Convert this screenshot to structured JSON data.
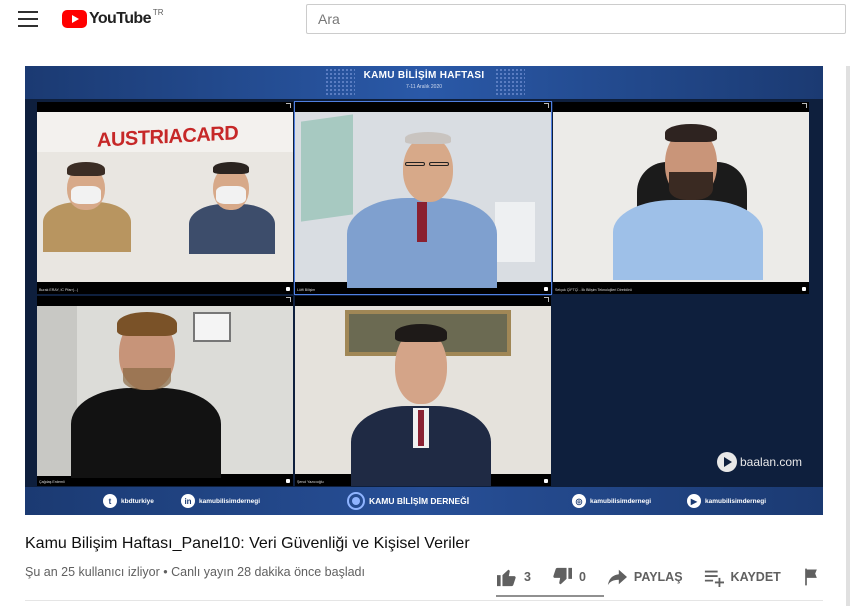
{
  "header": {
    "logo_text": "YouTube",
    "country_code": "TR",
    "search_placeholder": "Ara"
  },
  "video": {
    "banner_title": "KAMU BİLİŞİM HAFTASI",
    "banner_date": "7-11 Aralık 2020",
    "tiles": [
      {
        "name": "Burak ERAY, IC Pfarr(...)"
      },
      {
        "name": "Lütfi Bilişim"
      },
      {
        "name": "Selçuk ÇİFTÇİ - İlk Bilişim Teknolojileri Direktörü"
      },
      {
        "name": "Çağdaş Erdemli"
      },
      {
        "name": "Şenol Yazıcıoğlu"
      }
    ],
    "backdrop_sign": "AUSTRIACARD",
    "footer": {
      "twitter": "kbdturkiye",
      "linkedin": "kamubilisimdernegi",
      "center": "KAMU BİLİŞİM DERNEĞİ",
      "instagram": "kamubilisimdernegi",
      "youtube": "kamubilisimdernegi"
    },
    "watermark": "baalan.com"
  },
  "info": {
    "title": "Kamu Bilişim Haftası_Panel10: Veri Güvenliği ve Kişisel Veriler",
    "meta": "Şu an 25 kullanıcı izliyor • Canlı yayın 28 dakika önce başladı"
  },
  "actions": {
    "like_count": "3",
    "dislike_count": "0",
    "share_label": "PAYLAŞ",
    "save_label": "KAYDET"
  }
}
